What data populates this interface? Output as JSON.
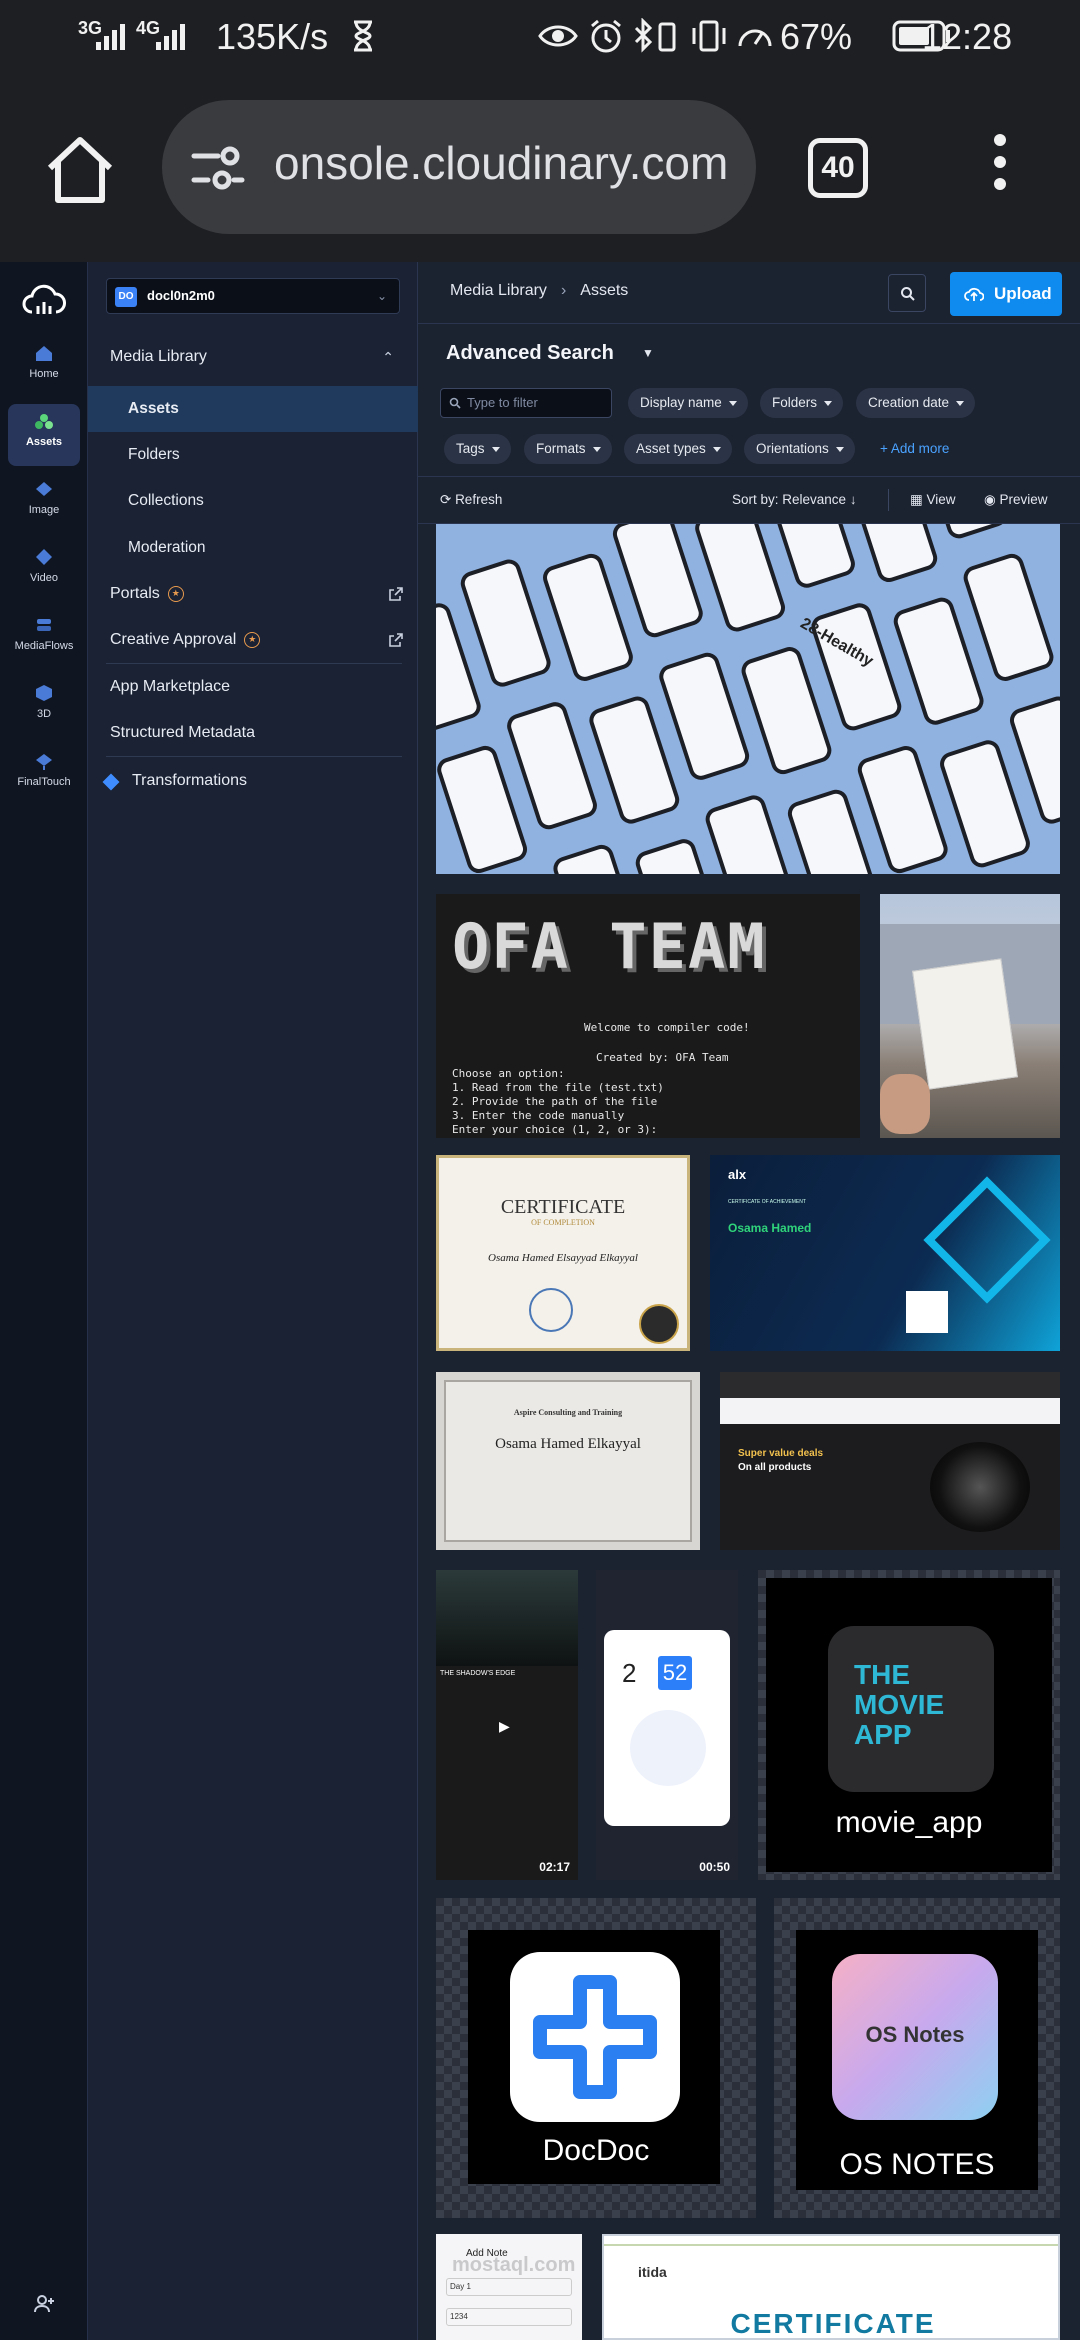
{
  "status_bar": {
    "network1": "3G",
    "network2": "4G",
    "speed": "135K/s",
    "battery": "67%",
    "time": "12:28"
  },
  "browser": {
    "url": "onsole.cloudinary.com",
    "tab_count": "40"
  },
  "rail": {
    "items": [
      {
        "label": "Home",
        "icon": "home-icon"
      },
      {
        "label": "Assets",
        "icon": "assets-icon"
      },
      {
        "label": "Image",
        "icon": "image-icon"
      },
      {
        "label": "Video",
        "icon": "video-icon"
      },
      {
        "label": "MediaFlows",
        "icon": "mediaflows-icon"
      },
      {
        "label": "3D",
        "icon": "3d-icon"
      },
      {
        "label": "FinalTouch",
        "icon": "finaltouch-icon"
      }
    ]
  },
  "sidebar": {
    "cloud_badge": "DO",
    "cloud_name": "docl0n2m0",
    "media_library": "Media Library",
    "assets": "Assets",
    "folders": "Folders",
    "collections": "Collections",
    "moderation": "Moderation",
    "portals": "Portals",
    "creative_approval": "Creative Approval",
    "app_marketplace": "App Marketplace",
    "structured_metadata": "Structured Metadata",
    "transformations": "Transformations"
  },
  "main": {
    "breadcrumb_root": "Media Library",
    "breadcrumb_current": "Assets",
    "upload_label": "Upload",
    "advanced_search": "Advanced Search",
    "filter_placeholder": "Type to filter",
    "chips": [
      "Display name",
      "Folders",
      "Creation date",
      "Tags",
      "Formats",
      "Asset types",
      "Orientations"
    ],
    "add_more": "Add more",
    "refresh": "Refresh",
    "sort_by": "Sort by: Relevance",
    "view": "View",
    "preview": "Preview"
  },
  "assets": {
    "mockup_label": "28-Healthy",
    "ofa_title": "OFA TEAM",
    "ofa_lines": [
      "Welcome to compiler code!",
      "Created by: OFA Team",
      "Choose an option:",
      "1. Read from the file (test.txt)",
      "2. Provide the path of the file",
      "3. Enter the code manually",
      "Enter your choice (1, 2, or 3):"
    ],
    "cert1_title": "CERTIFICATE",
    "cert1_sub": "OF COMPLETION",
    "cert1_name": "Osama Hamed Elsayyad Elkayyal",
    "cert2_brand": "alx",
    "cert2_heading": "CERTIFICATE OF ACHIEVEMENT",
    "cert2_name": "Osama Hamed",
    "cert3_org": "Aspire Consulting and Training",
    "cert3_name": "Osama Hamed Elkayyal",
    "shop_line1": "Super value deals",
    "shop_line2": "On all products",
    "video1_title": "THE SHADOW'S EDGE",
    "video1_duration": "02:17",
    "video2_hour": "2",
    "video2_minute": "52",
    "video2_duration": "00:50",
    "movie_logo_line1": "THE",
    "movie_logo_line2": "MOVIE",
    "movie_logo_line3": "APP",
    "movie_app": "movie_app",
    "docdoc": "DocDoc",
    "osnotes_logo": "OS Notes",
    "osnotes": "OS NOTES",
    "addnote_title": "Add Note",
    "addnote_field1": "Day 1",
    "addnote_field2": "1234",
    "watermark": "mostaql.com",
    "itida_brand": "itida",
    "itida_cert": "CERTIFICATE"
  }
}
